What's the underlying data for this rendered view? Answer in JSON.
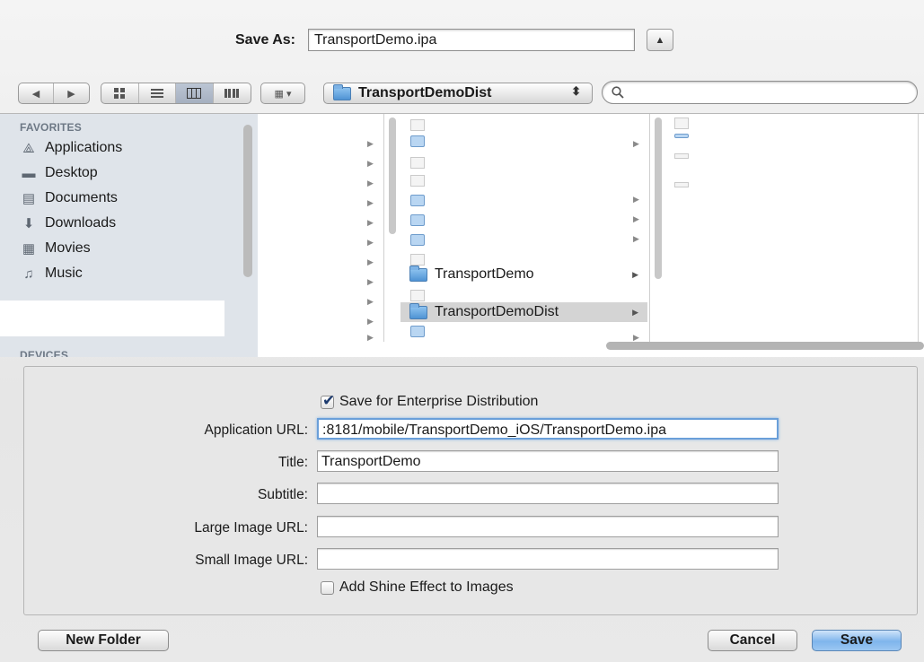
{
  "save_as": {
    "label": "Save As:",
    "filename": "TransportDemo.ipa",
    "expand_glyph": "▲"
  },
  "toolbar": {
    "back_glyph": "◀",
    "forward_glyph": "▶",
    "view_icons": [
      "icon-view-icon",
      "list-view-icon",
      "column-view-icon",
      "coverflow-view-icon"
    ],
    "arrange_glyph": "▦ ▾",
    "path_folder": "TransportDemoDist",
    "path_arrows": "⬍",
    "search_placeholder": ""
  },
  "sidebar": {
    "favorites_heading": "FAVORITES",
    "items": [
      {
        "label": "Applications",
        "icon": "applications-icon",
        "glyph": "⟁"
      },
      {
        "label": "Desktop",
        "icon": "desktop-icon",
        "glyph": "▬"
      },
      {
        "label": "Documents",
        "icon": "documents-icon",
        "glyph": "▤"
      },
      {
        "label": "Downloads",
        "icon": "downloads-icon",
        "glyph": "⬇"
      },
      {
        "label": "Movies",
        "icon": "movies-icon",
        "glyph": "▦"
      },
      {
        "label": "Music",
        "icon": "music-icon",
        "glyph": "♫"
      }
    ],
    "devices_heading": "DEVICES"
  },
  "browser": {
    "files": [
      {
        "name": "TransportDemo",
        "selected": false
      },
      {
        "name": "TransportDemoDist",
        "selected": true
      }
    ]
  },
  "options": {
    "enterprise_label": "Save for Enterprise Distribution",
    "enterprise_checked": true,
    "app_url_label": "Application URL:",
    "app_url_value": ":8181/mobile/TransportDemo_iOS/TransportDemo.ipa",
    "title_label": "Title:",
    "title_value": "TransportDemo",
    "subtitle_label": "Subtitle:",
    "subtitle_value": "",
    "large_image_label": "Large Image URL:",
    "large_image_value": "",
    "small_image_label": "Small Image URL:",
    "small_image_value": "",
    "shine_label": "Add Shine Effect to Images",
    "shine_checked": false
  },
  "buttons": {
    "new_folder": "New Folder",
    "cancel": "Cancel",
    "save": "Save"
  },
  "colors": {
    "accent": "#7fb5ec",
    "selection": "#d4d4d4",
    "sidebar_bg": "#dfe4ea"
  }
}
